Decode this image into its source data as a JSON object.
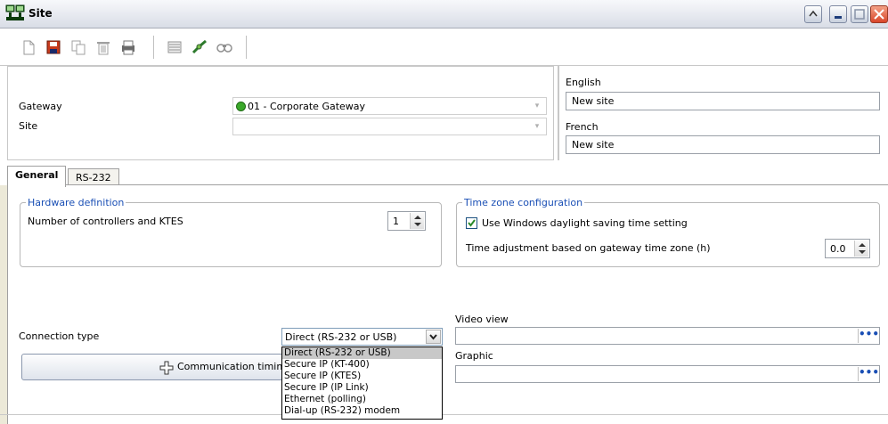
{
  "window": {
    "title": "Site",
    "app_icon": "network-computers-icon"
  },
  "toolbar": {
    "buttons": [
      {
        "icon": "new-icon"
      },
      {
        "icon": "save-icon"
      },
      {
        "icon": "copy-icon"
      },
      {
        "icon": "delete-icon"
      },
      {
        "icon": "print-icon"
      },
      {
        "icon": "list-icon"
      },
      {
        "icon": "link-icon"
      },
      {
        "icon": "find-icon"
      }
    ]
  },
  "header": {
    "gateway_label": "Gateway",
    "gateway_value": "01 - Corporate Gateway",
    "site_label": "Site",
    "site_value": "",
    "english_label": "English",
    "english_value": "New site",
    "french_label": "French",
    "french_value": "New site",
    "status_color": "#3aa82a"
  },
  "tabs": [
    {
      "label": "General",
      "active": true
    },
    {
      "label": "RS-232",
      "active": false
    }
  ],
  "hardware": {
    "legend": "Hardware definition",
    "controllers_label": "Number of controllers and KTES",
    "controllers_value": "1"
  },
  "timezone": {
    "legend": "Time zone configuration",
    "daylight_label": "Use Windows daylight saving time setting",
    "daylight_checked": true,
    "adjust_label": "Time adjustment based on gateway time zone (h)",
    "adjust_value": "0.0"
  },
  "connection": {
    "label": "Connection type",
    "selected": "Direct (RS-232 or USB)",
    "options": [
      "Direct (RS-232 or USB)",
      "Secure IP (KT-400)",
      "Secure IP (KTES)",
      "Secure IP (IP Link)",
      "Ethernet (polling)",
      "Dial-up (RS-232) modem"
    ],
    "timing_button": "Communication timing"
  },
  "video_view": {
    "label": "Video view",
    "value": "",
    "browse": "•••"
  },
  "graphic": {
    "label": "Graphic",
    "value": "",
    "browse": "•••"
  },
  "colors": {
    "accent": "#1a4fb5",
    "dropdown_selected": "#c8c8c8"
  }
}
